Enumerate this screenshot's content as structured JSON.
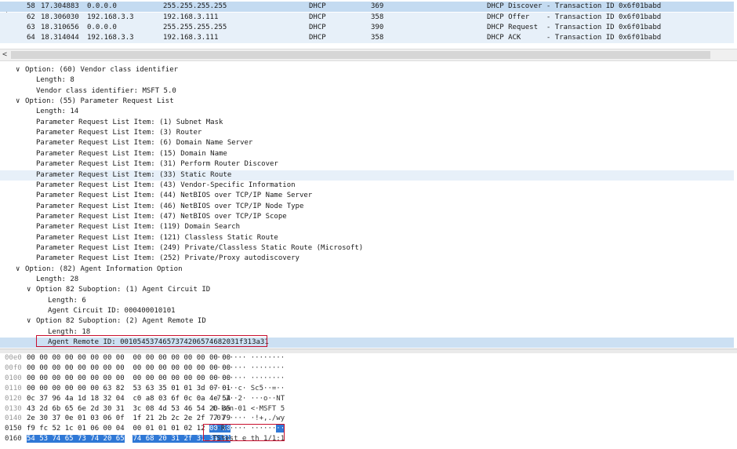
{
  "packets": [
    {
      "no": "58",
      "time": "17.304883",
      "src": "0.0.0.0",
      "dst": "255.255.255.255",
      "proto": "DHCP",
      "len": "369",
      "info": "DHCP Discover - Transaction ID 0x6f01babd"
    },
    {
      "no": "62",
      "time": "18.306030",
      "src": "192.168.3.3",
      "dst": "192.168.3.111",
      "proto": "DHCP",
      "len": "358",
      "info": "DHCP Offer    - Transaction ID 0x6f01babd"
    },
    {
      "no": "63",
      "time": "18.310656",
      "src": "0.0.0.0",
      "dst": "255.255.255.255",
      "proto": "DHCP",
      "len": "390",
      "info": "DHCP Request  - Transaction ID 0x6f01babd"
    },
    {
      "no": "64",
      "time": "18.314044",
      "src": "192.168.3.3",
      "dst": "192.168.3.111",
      "proto": "DHCP",
      "len": "358",
      "info": "DHCP ACK      - Transaction ID 0x6f01babd"
    }
  ],
  "scroll_left_glyph": "<",
  "details": [
    {
      "text": "Option: (60) Vendor class identifier",
      "indent": 0,
      "expand": true
    },
    {
      "text": "Length: 8",
      "indent": 1
    },
    {
      "text": "Vendor class identifier: MSFT 5.0",
      "indent": 1
    },
    {
      "text": "Option: (55) Parameter Request List",
      "indent": 0,
      "expand": true
    },
    {
      "text": "Length: 14",
      "indent": 1
    },
    {
      "text": "Parameter Request List Item: (1) Subnet Mask",
      "indent": 1
    },
    {
      "text": "Parameter Request List Item: (3) Router",
      "indent": 1
    },
    {
      "text": "Parameter Request List Item: (6) Domain Name Server",
      "indent": 1
    },
    {
      "text": "Parameter Request List Item: (15) Domain Name",
      "indent": 1
    },
    {
      "text": "Parameter Request List Item: (31) Perform Router Discover",
      "indent": 1
    },
    {
      "text": "Parameter Request List Item: (33) Static Route",
      "indent": 1,
      "state": "hl"
    },
    {
      "text": "Parameter Request List Item: (43) Vendor-Specific Information",
      "indent": 1
    },
    {
      "text": "Parameter Request List Item: (44) NetBIOS over TCP/IP Name Server",
      "indent": 1
    },
    {
      "text": "Parameter Request List Item: (46) NetBIOS over TCP/IP Node Type",
      "indent": 1
    },
    {
      "text": "Parameter Request List Item: (47) NetBIOS over TCP/IP Scope",
      "indent": 1
    },
    {
      "text": "Parameter Request List Item: (119) Domain Search",
      "indent": 1
    },
    {
      "text": "Parameter Request List Item: (121) Classless Static Route",
      "indent": 1
    },
    {
      "text": "Parameter Request List Item: (249) Private/Classless Static Route (Microsoft)",
      "indent": 1
    },
    {
      "text": "Parameter Request List Item: (252) Private/Proxy autodiscovery",
      "indent": 1
    },
    {
      "text": "Option: (82) Agent Information Option",
      "indent": 0,
      "expand": true
    },
    {
      "text": "Length: 28",
      "indent": 1
    },
    {
      "text": "Option 82 Suboption: (1) Agent Circuit ID",
      "indent": 1,
      "expand": true
    },
    {
      "text": "Length: 6",
      "indent": 2
    },
    {
      "text": "Agent Circuit ID: 000400010101",
      "indent": 2
    },
    {
      "text": "Option 82 Suboption: (2) Agent Remote ID",
      "indent": 1,
      "expand": true
    },
    {
      "text": "Length: 18",
      "indent": 2
    },
    {
      "text": "Agent Remote ID: 0010545374657374206574682031f313a31",
      "indent": 2,
      "state": "sel"
    }
  ],
  "hex": [
    {
      "off": "00e0",
      "b1": "00 00 00 00 00 00 00 00",
      "b2": "00 00 00 00 00 00 00 00",
      "ascii": "········ ········"
    },
    {
      "off": "00f0",
      "b1": "00 00 00 00 00 00 00 00",
      "b2": "00 00 00 00 00 00 00 00",
      "ascii": "········ ········"
    },
    {
      "off": "0100",
      "b1": "00 00 00 00 00 00 00 00",
      "b2": "00 00 00 00 00 00 00 00",
      "ascii": "········ ········"
    },
    {
      "off": "0110",
      "b1": "00 00 00 00 00 00 63 82",
      "b2": "53 63 35 01 01 3d 07 01",
      "ascii": "······c· Sc5··=··"
    },
    {
      "off": "0120",
      "b1": "0c 37 96 4a 1d 18 32 04",
      "b2": "c0 a8 03 6f 0c 0a 4e 54",
      "ascii": "·7·J··2· ···o··NT"
    },
    {
      "off": "0130",
      "b1": "43 2d 6b 65 6e 2d 30 31",
      "b2": "3c 08 4d 53 46 54 20 35",
      "ascii": "C-ken-01 <·MSFT 5"
    },
    {
      "off": "0140",
      "b1": "2e 30 37 0e 01 03 06 0f",
      "b2": "1f 21 2b 2c 2e 2f 77 79",
      "ascii": ".07····· ·!+,./wy"
    },
    {
      "off": "0150",
      "b1": "f9 fc 52 1c 01 06 00 04",
      "b2": "00 01 01 01 02 12",
      "b2sel": "00 10",
      "ascii": "··R····· ······",
      "asciisel": "··"
    },
    {
      "off": "0160",
      "b1": "54 53 74 65 73 74 20 65",
      "b2": "74 68 20 31 2f 31 3a 31",
      "ascii": "TStest e th 1/1:1",
      "allsel": true
    }
  ]
}
